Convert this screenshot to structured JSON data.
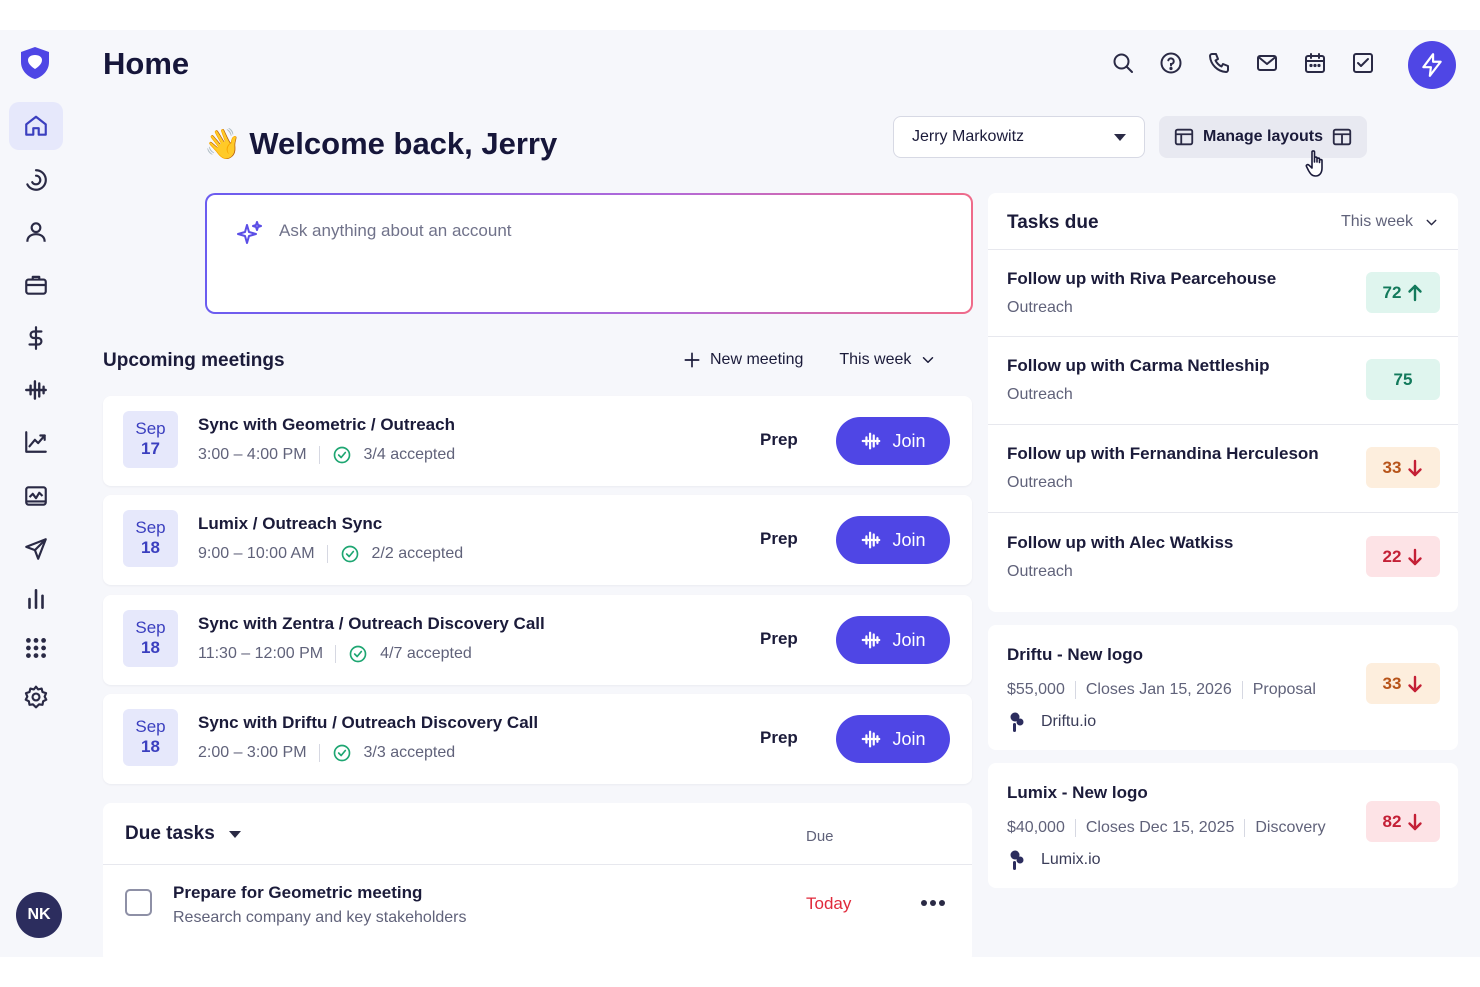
{
  "header": {
    "title": "Home",
    "icons": [
      "search-icon",
      "help-icon",
      "phone-icon",
      "mail-icon",
      "calendar-icon",
      "checklist-icon"
    ],
    "action_icon": "bolt-icon"
  },
  "sidebar": {
    "items": [
      {
        "icon": "home-icon",
        "active": true
      },
      {
        "icon": "activity-icon"
      },
      {
        "icon": "user-icon"
      },
      {
        "icon": "briefcase-icon"
      },
      {
        "icon": "dollar-icon"
      },
      {
        "icon": "waveform-icon"
      },
      {
        "icon": "trend-chart-icon"
      },
      {
        "icon": "dashboard-icon"
      },
      {
        "icon": "send-icon"
      },
      {
        "icon": "bar-chart-icon"
      },
      {
        "icon": "apps-grid-icon"
      },
      {
        "icon": "settings-icon"
      }
    ],
    "avatar_initials": "NK"
  },
  "welcome": {
    "emoji": "👋",
    "text": "Welcome back, Jerry"
  },
  "user_select": {
    "value": "Jerry Markowitz"
  },
  "manage_layouts": {
    "label": "Manage layouts"
  },
  "ask": {
    "placeholder": "Ask anything about an account"
  },
  "meetings": {
    "title": "Upcoming meetings",
    "new_meeting_label": "New meeting",
    "filter_label": "This week",
    "prep_label": "Prep",
    "join_label": "Join",
    "items": [
      {
        "month": "Sep",
        "day": "17",
        "title": "Sync with Geometric / Outreach",
        "time": "3:00 – 4:00 PM",
        "accepted": "3/4 accepted"
      },
      {
        "month": "Sep",
        "day": "18",
        "title": "Lumix / Outreach Sync",
        "time": "9:00 – 10:00 AM",
        "accepted": "2/2 accepted"
      },
      {
        "month": "Sep",
        "day": "18",
        "title": "Sync with Zentra / Outreach Discovery Call",
        "time": "11:30 – 12:00 PM",
        "accepted": "4/7 accepted"
      },
      {
        "month": "Sep",
        "day": "18",
        "title": "Sync with Driftu / Outreach Discovery Call",
        "time": "2:00 – 3:00 PM",
        "accepted": "3/3 accepted"
      }
    ]
  },
  "due_tasks": {
    "title": "Due tasks",
    "due_column": "Due",
    "items": [
      {
        "title": "Prepare for Geometric meeting",
        "subtitle": "Research company and key stakeholders",
        "due": "Today"
      }
    ]
  },
  "tasks_due": {
    "title": "Tasks due",
    "filter_label": "This week",
    "items": [
      {
        "title": "Follow up with Riva Pearcehouse",
        "subtitle": "Outreach",
        "score": "72",
        "trend": "up",
        "tone": "green"
      },
      {
        "title": "Follow up with Carma Nettleship",
        "subtitle": "Outreach",
        "score": "75",
        "trend": "none",
        "tone": "green"
      },
      {
        "title": "Follow up with Fernandina Herculeson",
        "subtitle": "Outreach",
        "score": "33",
        "trend": "down",
        "tone": "orange"
      },
      {
        "title": "Follow up with Alec Watkiss",
        "subtitle": "Outreach",
        "score": "22",
        "trend": "down",
        "tone": "red"
      }
    ]
  },
  "deals": [
    {
      "title": "Driftu - New logo",
      "amount": "$55,000",
      "closes": "Closes Jan 15, 2026",
      "stage": "Proposal",
      "company": "Driftu.io",
      "score": "33",
      "trend": "down",
      "tone": "orange"
    },
    {
      "title": "Lumix - New logo",
      "amount": "$40,000",
      "closes": "Closes Dec 15, 2025",
      "stage": "Discovery",
      "company": "Lumix.io",
      "score": "82",
      "trend": "down",
      "tone": "red"
    }
  ],
  "colors": {
    "accent": "#4f46e5",
    "active_nav_bg": "#e6e8fb",
    "score_green": "#137a5c",
    "score_orange": "#b7541a",
    "score_red": "#c42036",
    "due_today": "#e0293b"
  }
}
